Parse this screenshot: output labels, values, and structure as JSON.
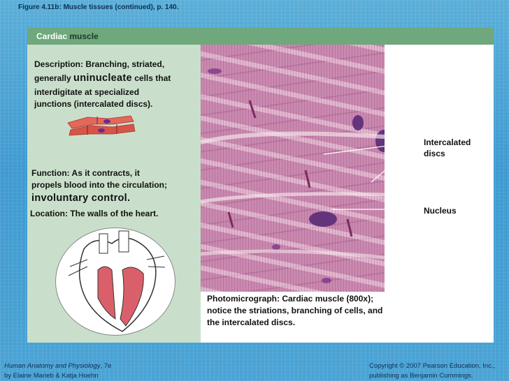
{
  "figure_caption": "Figure 4.11b:  Muscle tissues (continued), p. 140.",
  "header": {
    "title_part1": "Cardiac",
    "title_part2": "muscle"
  },
  "description": {
    "line1": "Description: Branching, striated,",
    "line2_prefix": "generally ",
    "line2_emph": "uninucleate",
    "line2_suffix": " cells that",
    "line3": "interdigitate at specialized",
    "line4": "junctions (intercalated discs)."
  },
  "function": {
    "line1": "Function: As it contracts, it",
    "line2": "propels blood into the circulation;",
    "line3": "involuntary control."
  },
  "location": "Location: The walls of the heart.",
  "photo_caption": {
    "line1": "Photomicrograph: Cardiac muscle (800x);",
    "line2": "notice the striations, branching of cells, and",
    "line3": "the intercalated discs."
  },
  "labels": {
    "intercalated_1": "Intercalated",
    "intercalated_2": "discs",
    "nucleus": "Nucleus"
  },
  "footer": {
    "book_title": "Human Anatomy and Physiology",
    "edition": ", 7e",
    "authors": "by Elaine Marieb & Katja Hoehn",
    "copyright1": "Copyright © 2007 Pearson Education, Inc.,",
    "copyright2": "publishing as Benjamin Cummings."
  },
  "colors": {
    "background": "#4aa3d4",
    "header_green": "#6fa87c",
    "left_panel": "#c9dfcb",
    "tissue": "#c98ab0",
    "cell_red": "#e2685a"
  }
}
